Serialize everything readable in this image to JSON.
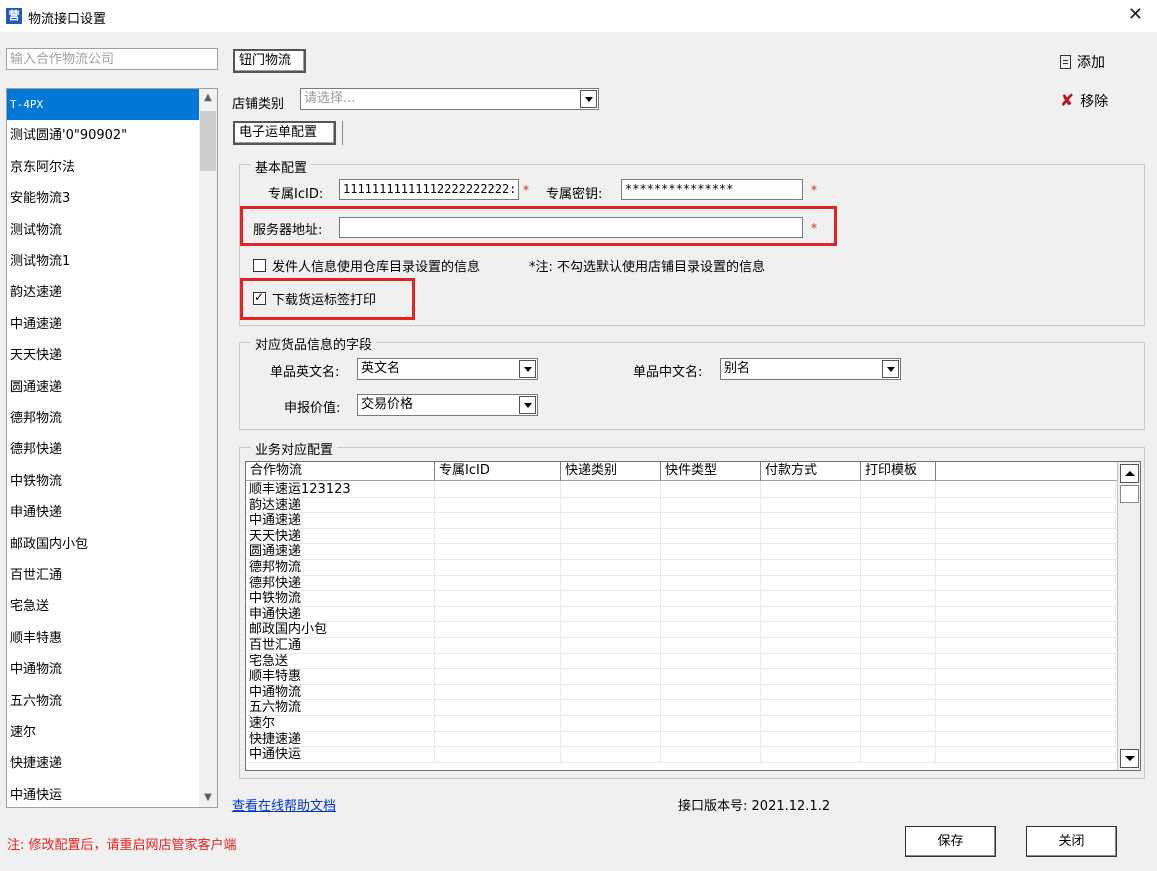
{
  "window": {
    "title": "物流接口设置",
    "app_icon_glyph": "营",
    "close_glyph": "✕"
  },
  "search": {
    "placeholder": "输入合作物流公司"
  },
  "companies": [
    "T-4PX",
    "测试圆通'0\"90902\"",
    "京东阿尔法",
    "安能物流3",
    "测试物流",
    "测试物流1",
    "韵达速递",
    "中通速递",
    "天天快递",
    "圆通速递",
    "德邦物流",
    "德邦快递",
    "中铁物流",
    "申通快递",
    "邮政国内小包",
    "百世汇通",
    "宅急送",
    "顺丰特惠",
    "中通物流",
    "五六物流",
    "速尔",
    "快捷速递",
    "中通快运"
  ],
  "selected_company": "T-4PX",
  "tabs": {
    "company": "钮门物流",
    "ebill": "电子运单配置"
  },
  "actions": {
    "add": "添加",
    "remove": "移除"
  },
  "shop_type": {
    "label": "店铺类别",
    "placeholder": "请选择..."
  },
  "basic": {
    "title": "基本配置",
    "icid_label": "专属IcID:",
    "icid_value": "11111111111112222222222:",
    "secret_label": "专属密钥:",
    "secret_value": "***************",
    "server_label": "服务器地址:",
    "server_value": "",
    "required_mark": "*",
    "sender_check_label": "发件人信息使用仓库目录设置的信息",
    "sender_note": "*注: 不勾选默认使用店铺目录设置的信息",
    "sender_checked": false,
    "download_label": "下载货运标签打印",
    "download_checked": true
  },
  "goods": {
    "title": "对应货品信息的字段",
    "en_label": "单品英文名:",
    "en_value": "英文名",
    "cn_label": "单品中文名:",
    "cn_value": "别名",
    "declare_label": "申报价值:",
    "declare_value": "交易价格"
  },
  "business": {
    "title": "业务对应配置",
    "columns": [
      "合作物流",
      "专属IcID",
      "快递类别",
      "快件类型",
      "付款方式",
      "打印模板"
    ],
    "rows": [
      "顺丰速运123123",
      "韵达速递",
      "中通速递",
      "天天快递",
      "圆通速递",
      "德邦物流",
      "德邦快递",
      "中铁物流",
      "申通快递",
      "邮政国内小包",
      "百世汇通",
      "宅急送",
      "顺丰特惠",
      "中通物流",
      "五六物流",
      "速尔",
      "快捷速递",
      "中通快运"
    ]
  },
  "footer": {
    "help_link": "查看在线帮助文档",
    "version_label": "接口版本号:",
    "version_value": "2021.12.1.2",
    "note": "注: 修改配置后，请重启网店管家客户端",
    "save": "保存",
    "close": "关闭"
  },
  "colors": {
    "selection": "#0078d7",
    "highlight_red": "#e32222",
    "link": "#0033cc"
  }
}
